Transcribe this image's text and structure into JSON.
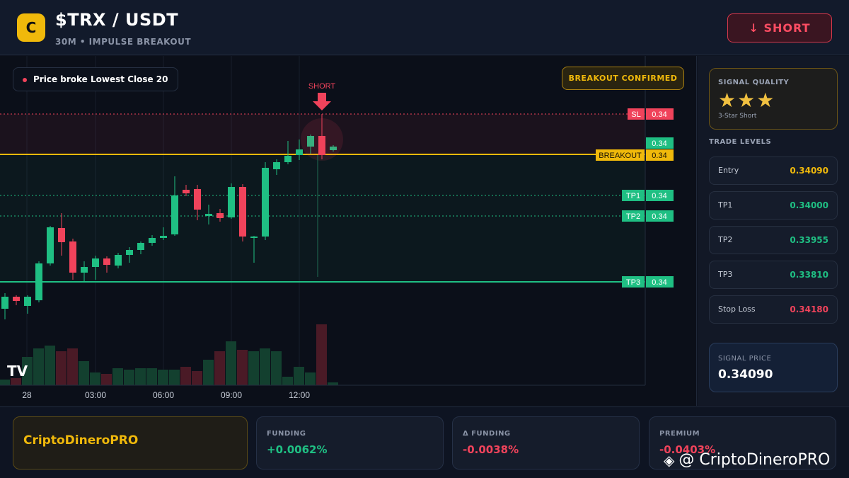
{
  "header": {
    "logo_letter": "C",
    "title": "$TRX / USDT",
    "subtitle": "30M • IMPULSE BREAKOUT",
    "short_button": "↓ SHORT"
  },
  "chart": {
    "info_pill": "Price broke Lowest Close 20",
    "confirm_pill": "BREAKOUT CONFIRMED",
    "short_marker": "SHORT",
    "tv_logo": "TV",
    "levels": [
      {
        "name": "SL",
        "tag": "SL",
        "value": "0.34",
        "color": "#f0435b"
      },
      {
        "name": "current",
        "tag": "",
        "value": "0.34",
        "color": "#1fbf83"
      },
      {
        "name": "breakout",
        "tag": "BREAKOUT",
        "value": "0.34",
        "color": "#f0b90b"
      },
      {
        "name": "tp1",
        "tag": "TP1",
        "value": "0.34",
        "color": "#1fbf83"
      },
      {
        "name": "tp2",
        "tag": "TP2",
        "value": "0.34",
        "color": "#1fbf83"
      },
      {
        "name": "tp3",
        "tag": "TP3",
        "value": "0.34",
        "color": "#1fbf83"
      }
    ],
    "time_labels": [
      "28",
      "03:00",
      "06:00",
      "09:00",
      "12:00"
    ],
    "colors": {
      "up": "#1fbf83",
      "down": "#f0435b",
      "gold": "#f0b90b"
    },
    "candles": [
      {
        "dir": "up"
      },
      {
        "dir": "down"
      },
      {
        "dir": "up"
      },
      {
        "dir": "up"
      },
      {
        "dir": "up"
      },
      {
        "dir": "down"
      },
      {
        "dir": "down"
      },
      {
        "dir": "up"
      },
      {
        "dir": "up"
      },
      {
        "dir": "down"
      },
      {
        "dir": "up"
      },
      {
        "dir": "up"
      },
      {
        "dir": "up"
      },
      {
        "dir": "up"
      },
      {
        "dir": "up"
      },
      {
        "dir": "up"
      },
      {
        "dir": "down"
      },
      {
        "dir": "down"
      },
      {
        "dir": "up"
      },
      {
        "dir": "down"
      },
      {
        "dir": "up"
      },
      {
        "dir": "down"
      },
      {
        "dir": "up"
      },
      {
        "dir": "up"
      },
      {
        "dir": "up"
      },
      {
        "dir": "up"
      },
      {
        "dir": "up"
      },
      {
        "dir": "up"
      },
      {
        "dir": "down"
      },
      {
        "dir": "up"
      }
    ]
  },
  "sidebar": {
    "quality_title": "SIGNAL QUALITY",
    "stars": "★★★",
    "quality_sub": "3-Star Short",
    "levels_title": "TRADE LEVELS",
    "levels": [
      {
        "label": "Entry",
        "value": "0.34090",
        "color": "#f0b90b"
      },
      {
        "label": "TP1",
        "value": "0.34000",
        "color": "#1fbf83"
      },
      {
        "label": "TP2",
        "value": "0.33955",
        "color": "#1fbf83"
      },
      {
        "label": "TP3",
        "value": "0.33810",
        "color": "#1fbf83"
      },
      {
        "label": "Stop Loss",
        "value": "0.34180",
        "color": "#f0435b"
      }
    ],
    "signal_price_title": "SIGNAL PRICE",
    "signal_price": "0.34090"
  },
  "footer": {
    "brand": "CriptoDineroPRO",
    "stats": [
      {
        "label": "FUNDING",
        "value": "+0.0062%",
        "color": "#1fbf83"
      },
      {
        "label": "Δ FUNDING",
        "value": "-0.0038%",
        "color": "#f0435b"
      },
      {
        "label": "PREMIUM",
        "value": "-0.0403%",
        "color": "#f0435b"
      }
    ],
    "watermark": "@ CriptoDineroPRO"
  }
}
